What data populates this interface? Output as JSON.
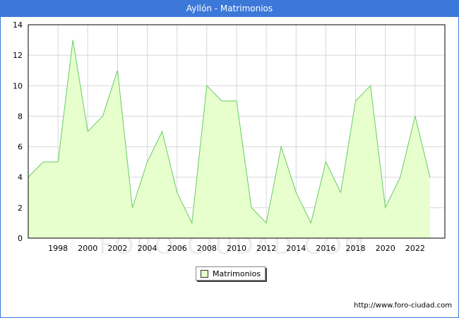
{
  "header": {
    "title": "Ayllón - Matrimonios"
  },
  "colors": {
    "title_bar": "#3c78d8",
    "area_fill": "#e6ffcc",
    "line": "#66cc66",
    "grid": "#d8d8d8"
  },
  "watermark": "FORO-CIUDAD.COM",
  "footer": {
    "source": "http://www.foro-ciudad.com"
  },
  "chart_data": {
    "type": "area",
    "title": "Ayllón - Matrimonios",
    "xlabel": "",
    "ylabel": "",
    "x": [
      1996,
      1997,
      1998,
      1999,
      2000,
      2001,
      2002,
      2003,
      2004,
      2005,
      2006,
      2007,
      2008,
      2009,
      2010,
      2011,
      2012,
      2013,
      2014,
      2015,
      2016,
      2017,
      2018,
      2019,
      2020,
      2021,
      2022,
      2023
    ],
    "series": [
      {
        "name": "Matrimonios",
        "values": [
          4,
          5,
          5,
          13,
          7,
          8,
          11,
          2,
          5,
          7,
          3,
          1,
          10,
          9,
          9,
          2,
          1,
          6,
          3,
          1,
          5,
          3,
          9,
          10,
          2,
          4,
          8,
          4
        ]
      }
    ],
    "xticks": [
      1998,
      2000,
      2002,
      2004,
      2006,
      2008,
      2010,
      2012,
      2014,
      2016,
      2018,
      2020,
      2022
    ],
    "yticks": [
      0,
      2,
      4,
      6,
      8,
      10,
      12,
      14
    ],
    "xlim": [
      1996,
      2024
    ],
    "ylim": [
      0,
      14
    ],
    "grid": true,
    "legend_position": "bottom-center"
  }
}
